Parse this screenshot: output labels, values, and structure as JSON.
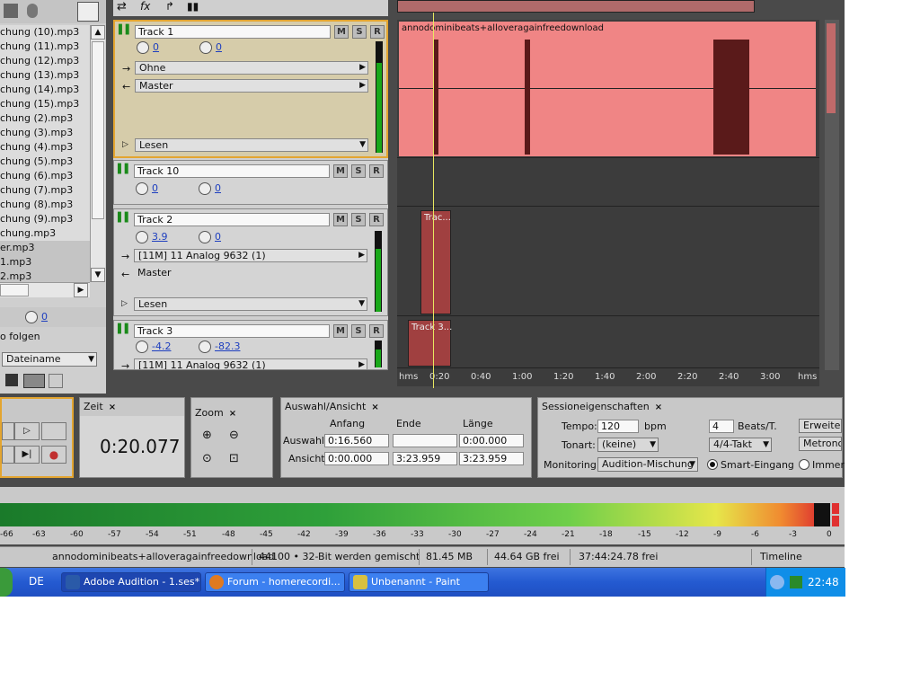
{
  "files": {
    "items": [
      "chung (10).mp3",
      "chung (11).mp3",
      "chung (12).mp3",
      "chung (13).mp3",
      "chung (14).mp3",
      "chung (15).mp3",
      "chung (2).mp3",
      "chung (3).mp3",
      "chung (4).mp3",
      "chung (5).mp3",
      "chung (6).mp3",
      "chung (7).mp3",
      "chung (8).mp3",
      "chung (9).mp3",
      "chung.mp3",
      "er.mp3",
      "1.mp3",
      "2.mp3"
    ],
    "volume_value": "0",
    "follow_label": "o folgen",
    "sort_label": "Dateiname"
  },
  "tracks": [
    {
      "name": "Track 1",
      "volume": "0",
      "pan": "0",
      "input": "Ohne",
      "output": "Master",
      "automation": "Lesen"
    },
    {
      "name": "Track 10",
      "volume": "0",
      "pan": "0"
    },
    {
      "name": "Track 2",
      "volume": "3.9",
      "pan": "0",
      "input": "[11M] 11 Analog 9632 (1)",
      "output": "Master",
      "automation": "Lesen"
    },
    {
      "name": "Track 3",
      "volume": "-4.2",
      "pan": "-82.3",
      "input": "[11M] 11 Analog 9632 (1)"
    }
  ],
  "track_buttons": {
    "mute": "M",
    "solo": "S",
    "record": "R"
  },
  "timeline": {
    "clip1_label": "annodominibeats+alloveragainfreedownload",
    "clip2_label": "Trac...",
    "clip3_label": "Track 3...",
    "ruler": [
      "hms",
      "0:20",
      "0:40",
      "1:00",
      "1:20",
      "1:40",
      "2:00",
      "2:20",
      "2:40",
      "3:00",
      "hms"
    ]
  },
  "time_panel": {
    "tab": "Zeit",
    "value": "0:20.077"
  },
  "zoom_panel": {
    "tab": "Zoom"
  },
  "selection_panel": {
    "tab": "Auswahl/Ansicht",
    "col_start": "Anfang",
    "col_end": "Ende",
    "col_length": "Länge",
    "row_selection": "Auswahl",
    "row_view": "Ansicht",
    "sel_start": "0:16.560",
    "sel_end": "",
    "sel_length": "0:00.000",
    "view_start": "0:00.000",
    "view_end": "3:23.959",
    "view_length": "3:23.959"
  },
  "session_panel": {
    "tab": "Sessioneigenschaften",
    "tempo_label": "Tempo:",
    "tempo_value": "120",
    "bpm_label": "bpm",
    "beats_value": "4",
    "beats_label": "Beats/T.",
    "key_label": "Tonart:",
    "key_value": "(keine)",
    "meter_value": "4/4-Takt",
    "monitoring_label": "Monitoring:",
    "monitoring_value": "Audition-Mischung",
    "smart_input": "Smart-Eingang",
    "always": "Immer",
    "advanced_button": "Erweitert",
    "metronome_button": "Metronom"
  },
  "level_meter": {
    "ticks": [
      "-66",
      "-63",
      "-60",
      "-57",
      "-54",
      "-51",
      "-48",
      "-45",
      "-42",
      "-39",
      "-36",
      "-33",
      "-30",
      "-27",
      "-24",
      "-21",
      "-18",
      "-15",
      "-12",
      "-9",
      "-6",
      "-3",
      "0"
    ]
  },
  "status": {
    "file": "annodominibeats+alloveragainfreedownload",
    "format": "44100 • 32-Bit werden gemischt",
    "size": "81.45 MB",
    "free": "44.64 GB frei",
    "time_free": "37:44:24.78 frei",
    "view": "Timeline"
  },
  "taskbar": {
    "lang": "DE",
    "items": [
      {
        "label": "Adobe Audition - 1.ses*"
      },
      {
        "label": "Forum - homerecordi..."
      },
      {
        "label": "Unbenannt - Paint"
      }
    ],
    "clock": "22:48"
  }
}
